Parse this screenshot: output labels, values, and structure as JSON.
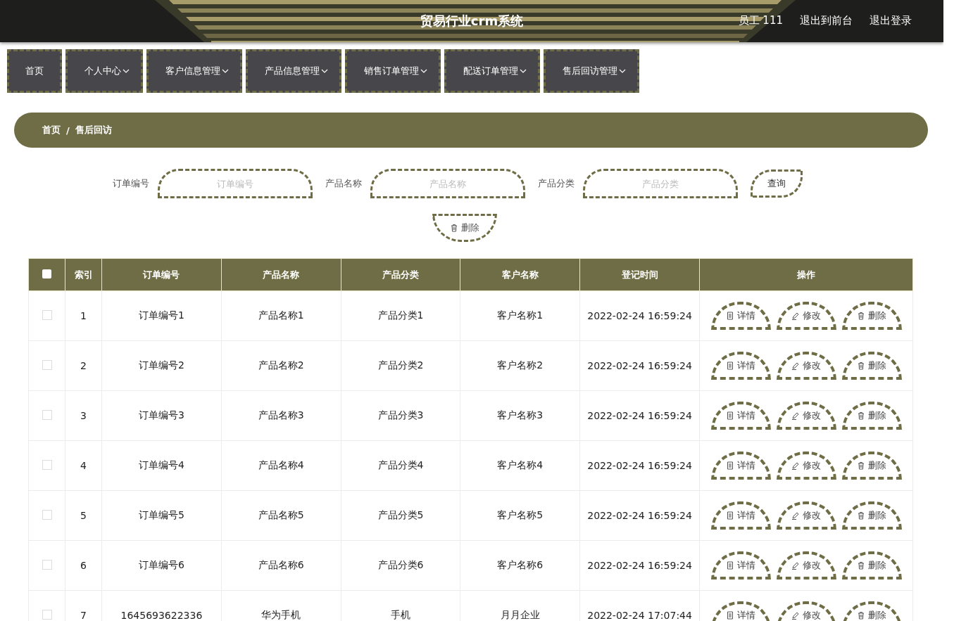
{
  "header": {
    "title": "贸易行业crm系统",
    "user": "员工 111",
    "links": [
      "退出到前台",
      "退出登录"
    ]
  },
  "nav": [
    {
      "label": "首页",
      "dropdown": false
    },
    {
      "label": "个人中心",
      "dropdown": true
    },
    {
      "label": "客户信息管理",
      "dropdown": true
    },
    {
      "label": "产品信息管理",
      "dropdown": true
    },
    {
      "label": "销售订单管理",
      "dropdown": true
    },
    {
      "label": "配送订单管理",
      "dropdown": true
    },
    {
      "label": "售后回访管理",
      "dropdown": true
    }
  ],
  "breadcrumb": [
    "首页",
    "/",
    "售后回访"
  ],
  "search": {
    "fields": [
      {
        "label": "订单编号",
        "placeholder": "订单编号"
      },
      {
        "label": "产品名称",
        "placeholder": "产品名称"
      },
      {
        "label": "产品分类",
        "placeholder": "产品分类"
      }
    ],
    "query_button": "查询",
    "delete_button": "删除"
  },
  "table": {
    "select_all": {
      "checked": false
    },
    "columns": [
      "索引",
      "订单编号",
      "产品名称",
      "产品分类",
      "客户名称",
      "登记时间",
      "操作"
    ],
    "rows": [
      {
        "checked": false,
        "cells": [
          "1",
          "订单编号1",
          "产品名称1",
          "产品分类1",
          "客户名称1",
          "2022-02-24 16:59:24"
        ],
        "actions": [
          "详情",
          "修改",
          "删除"
        ]
      },
      {
        "checked": false,
        "cells": [
          "2",
          "订单编号2",
          "产品名称2",
          "产品分类2",
          "客户名称2",
          "2022-02-24 16:59:24"
        ],
        "actions": [
          "详情",
          "修改",
          "删除"
        ]
      },
      {
        "checked": false,
        "cells": [
          "3",
          "订单编号3",
          "产品名称3",
          "产品分类3",
          "客户名称3",
          "2022-02-24 16:59:24"
        ],
        "actions": [
          "详情",
          "修改",
          "删除"
        ]
      },
      {
        "checked": false,
        "cells": [
          "4",
          "订单编号4",
          "产品名称4",
          "产品分类4",
          "客户名称4",
          "2022-02-24 16:59:24"
        ],
        "actions": [
          "详情",
          "修改",
          "删除"
        ]
      },
      {
        "checked": false,
        "cells": [
          "5",
          "订单编号5",
          "产品名称5",
          "产品分类5",
          "客户名称5",
          "2022-02-24 16:59:24"
        ],
        "actions": [
          "详情",
          "修改",
          "删除"
        ]
      },
      {
        "checked": false,
        "cells": [
          "6",
          "订单编号6",
          "产品名称6",
          "产品分类6",
          "客户名称6",
          "2022-02-24 16:59:24"
        ],
        "actions": [
          "详情",
          "修改",
          "删除"
        ]
      },
      {
        "checked": false,
        "cells": [
          "7",
          "1645693622336",
          "华为手机",
          "手机",
          "月月企业",
          "2022-02-24 17:07:44"
        ],
        "actions": [
          "详情",
          "修改",
          "删除"
        ]
      }
    ]
  }
}
